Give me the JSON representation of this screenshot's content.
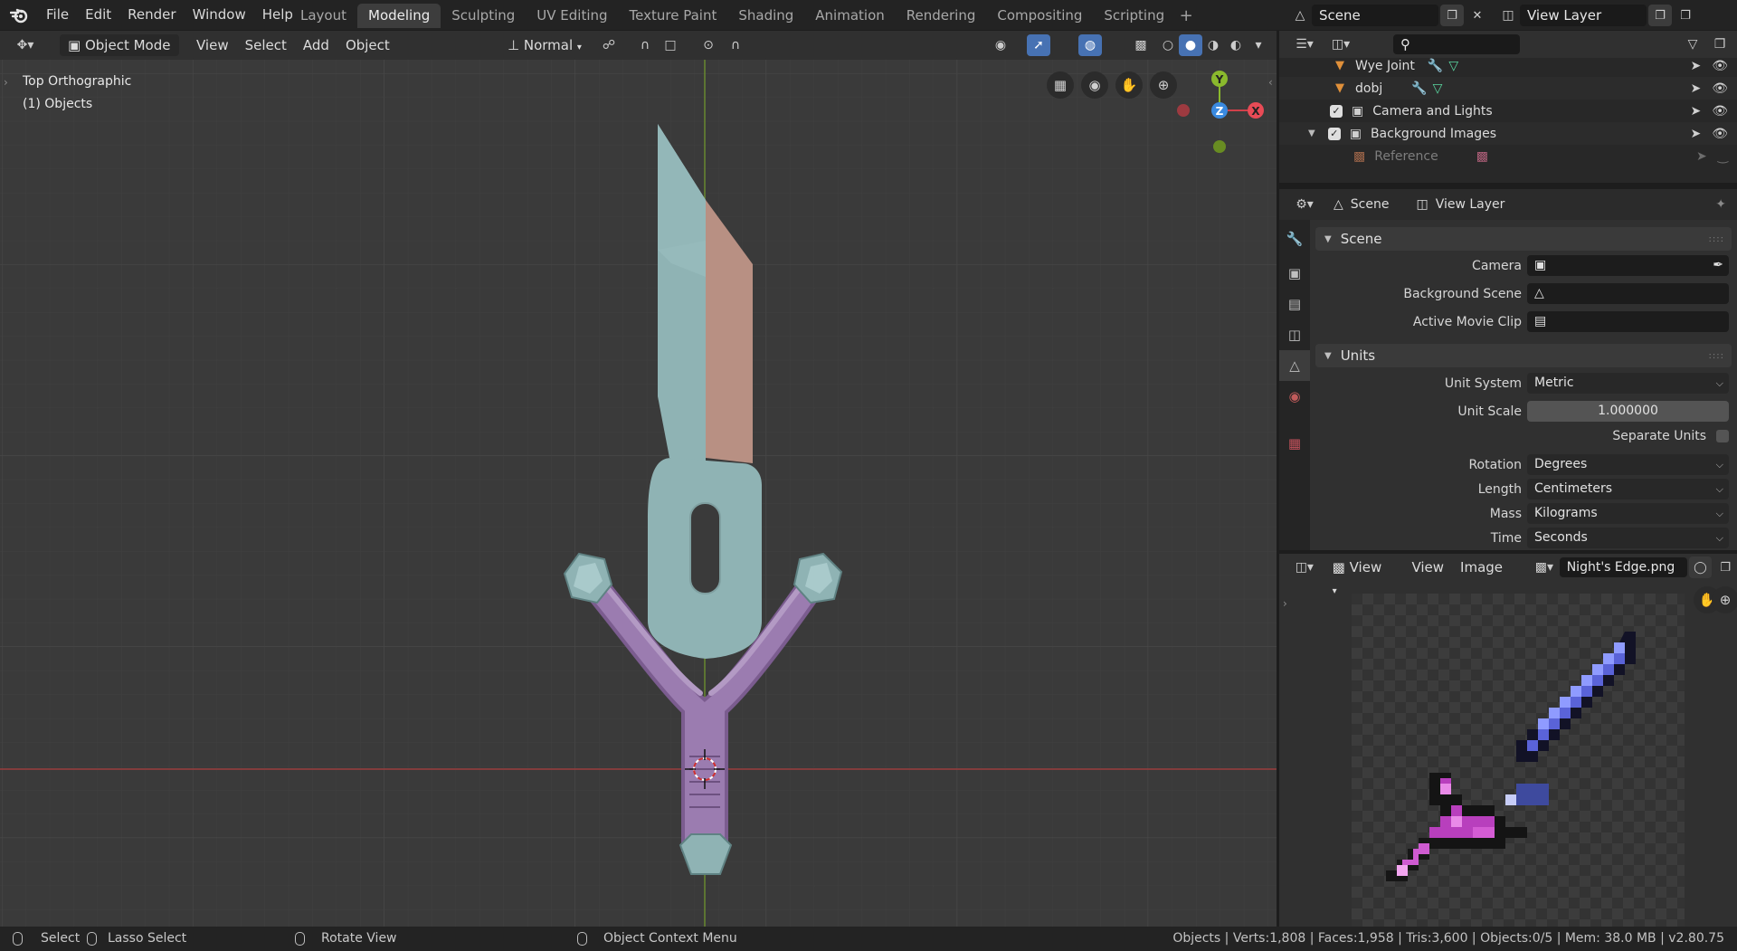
{
  "menu": {
    "items": [
      "File",
      "Edit",
      "Render",
      "Window",
      "Help"
    ]
  },
  "workspaces": {
    "tabs": [
      "Layout",
      "Modeling",
      "Sculpting",
      "UV Editing",
      "Texture Paint",
      "Shading",
      "Animation",
      "Rendering",
      "Compositing",
      "Scripting"
    ],
    "active": "Modeling",
    "add": "+"
  },
  "scene_picker": {
    "scene": "Scene",
    "view_layer": "View Layer"
  },
  "viewport": {
    "mode": "Object Mode",
    "menus": [
      "View",
      "Select",
      "Add",
      "Object"
    ],
    "orientation": "Normal",
    "info_line1": "Top Orthographic",
    "info_line2": "(1) Objects",
    "gizmo": {
      "y": "Y",
      "z": "Z",
      "x": "X"
    },
    "colors": {
      "grid_bg": "#3a3a3a",
      "x_axis": "#9a3c3c",
      "y_axis": "#6c8d2f",
      "blade_teal": "#8fb3b4",
      "blade_edge": "#b89083",
      "handle_purple": "#9b7cb0"
    }
  },
  "outliner": {
    "rows": [
      {
        "label": "Wye Joint",
        "icon": "mesh-triangle-icon"
      },
      {
        "label": "dobj",
        "icon": "mesh-triangle-icon"
      },
      {
        "label": "Camera and Lights",
        "icon": "collection-icon"
      },
      {
        "label": "Background Images",
        "icon": "collection-icon"
      },
      {
        "label": "Reference",
        "icon": "image-icon"
      }
    ]
  },
  "properties": {
    "header_scene": "Scene",
    "header_view_layer": "View Layer",
    "scene_panel": {
      "title": "Scene",
      "camera_label": "Camera",
      "background_scene_label": "Background Scene",
      "active_movie_clip_label": "Active Movie Clip"
    },
    "units_panel": {
      "title": "Units",
      "unit_system_label": "Unit System",
      "unit_system": "Metric",
      "unit_scale_label": "Unit Scale",
      "unit_scale": "1.000000",
      "separate_units_label": "Separate Units",
      "rotation_label": "Rotation",
      "rotation": "Degrees",
      "length_label": "Length",
      "length": "Centimeters",
      "mass_label": "Mass",
      "mass": "Kilograms",
      "time_label": "Time",
      "time": "Seconds"
    }
  },
  "image_editor": {
    "view_dropdown": "View",
    "menus": [
      "View",
      "Image"
    ],
    "image_name": "Night's Edge.png"
  },
  "statusbar": {
    "select": "Select",
    "lasso": "Lasso Select",
    "rotate": "Rotate View",
    "context": "Object Context Menu",
    "stats": "Objects | Verts:1,808 | Faces:1,958 | Tris:3,600 | Objects:0/5 | Mem: 38.0 MB | v2.80.75"
  }
}
